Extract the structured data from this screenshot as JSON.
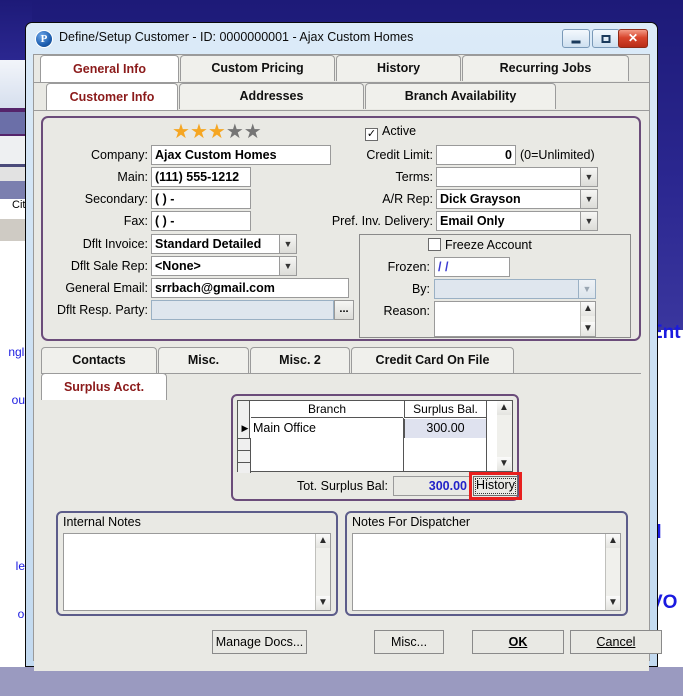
{
  "background": {
    "right_texts": [
      "Ent",
      "d ",
      "VO"
    ],
    "left_window": {
      "col_header": "City",
      "rows": [
        "",
        "ngla",
        "ous",
        "",
        "les",
        "od"
      ]
    }
  },
  "window": {
    "icon": "app-logo-icon",
    "title": "Define/Setup Customer - ID: 0000000001 - Ajax Custom Homes",
    "controls": {
      "minimize": "minimize-icon",
      "maximize": "maximize-icon",
      "close": "✕"
    }
  },
  "tabs_primary": [
    {
      "label": "General Info",
      "active": true
    },
    {
      "label": "Custom Pricing",
      "active": false
    },
    {
      "label": "History",
      "active": false
    },
    {
      "label": "Recurring Jobs",
      "active": false
    }
  ],
  "tabs_secondary": [
    {
      "label": "Customer Info",
      "active": true
    },
    {
      "label": "Addresses",
      "active": false
    },
    {
      "label": "Branch Availability",
      "active": false
    }
  ],
  "customer": {
    "rating": {
      "filled": 3,
      "total": 5,
      "star_on_color": "#f5a623",
      "star_off_color": "#757575"
    },
    "fields": {
      "company_label": "Company:",
      "company_value": "Ajax Custom Homes",
      "main_label": "Main:",
      "main_value": "(111) 555-1212",
      "secondary_label": "Secondary:",
      "secondary_value": "(  )    -",
      "fax_label": "Fax:",
      "fax_value": "(  )    -",
      "dflt_invoice_label": "Dflt Invoice:",
      "dflt_invoice_value": "Standard Detailed",
      "dflt_sale_rep_label": "Dflt Sale Rep:",
      "dflt_sale_rep_value": "<None>",
      "general_email_label": "General Email:",
      "general_email_value": "srrbach@gmail.com",
      "dflt_resp_party_label": "Dflt Resp. Party:",
      "dflt_resp_party_value": "",
      "ellipsis_label": "..."
    },
    "right": {
      "active_label": "Active",
      "active_checked": true,
      "credit_limit_label": "Credit Limit:",
      "credit_limit_value": "0",
      "credit_limit_hint": "(0=Unlimited)",
      "terms_label": "Terms:",
      "terms_value": "",
      "ar_rep_label": "A/R Rep:",
      "ar_rep_value": "Dick Grayson",
      "pref_inv_delivery_label": "Pref. Inv. Delivery:",
      "pref_inv_delivery_value": "Email Only"
    },
    "freeze": {
      "freeze_account_label": "Freeze Account",
      "freeze_checked": false,
      "frozen_label": "Frozen:",
      "frozen_value": "/  /",
      "by_label": "By:",
      "by_value": "",
      "reason_label": "Reason:",
      "reason_value": ""
    }
  },
  "tabs_bottom": [
    {
      "label": "Contacts",
      "active": false
    },
    {
      "label": "Misc.",
      "active": false
    },
    {
      "label": "Misc. 2",
      "active": false
    },
    {
      "label": "Credit Card On File",
      "active": false
    },
    {
      "label": "Surplus Acct.",
      "active": true
    }
  ],
  "surplus": {
    "columns": [
      "Branch",
      "Surplus Bal."
    ],
    "rows": [
      {
        "branch": "Main Office",
        "surplus_bal": "300.00"
      }
    ],
    "total_label": "Tot. Surplus Bal:",
    "total_value": "300.00",
    "history_button": "History",
    "highlight_color": "#e8201e"
  },
  "notes": {
    "internal_title": "Internal Notes",
    "internal_value": "",
    "dispatcher_title": "Notes For Dispatcher",
    "dispatcher_value": ""
  },
  "footer": {
    "manage_docs": "Manage Docs...",
    "misc": "Misc...",
    "ok": "OK",
    "ok_accel": "O",
    "cancel": "Cancel",
    "cancel_accel": "C"
  },
  "icons": {
    "scroll_up": "▲",
    "scroll_down": "▼",
    "combo_arrow": "▼",
    "row_indicator": "▶"
  }
}
